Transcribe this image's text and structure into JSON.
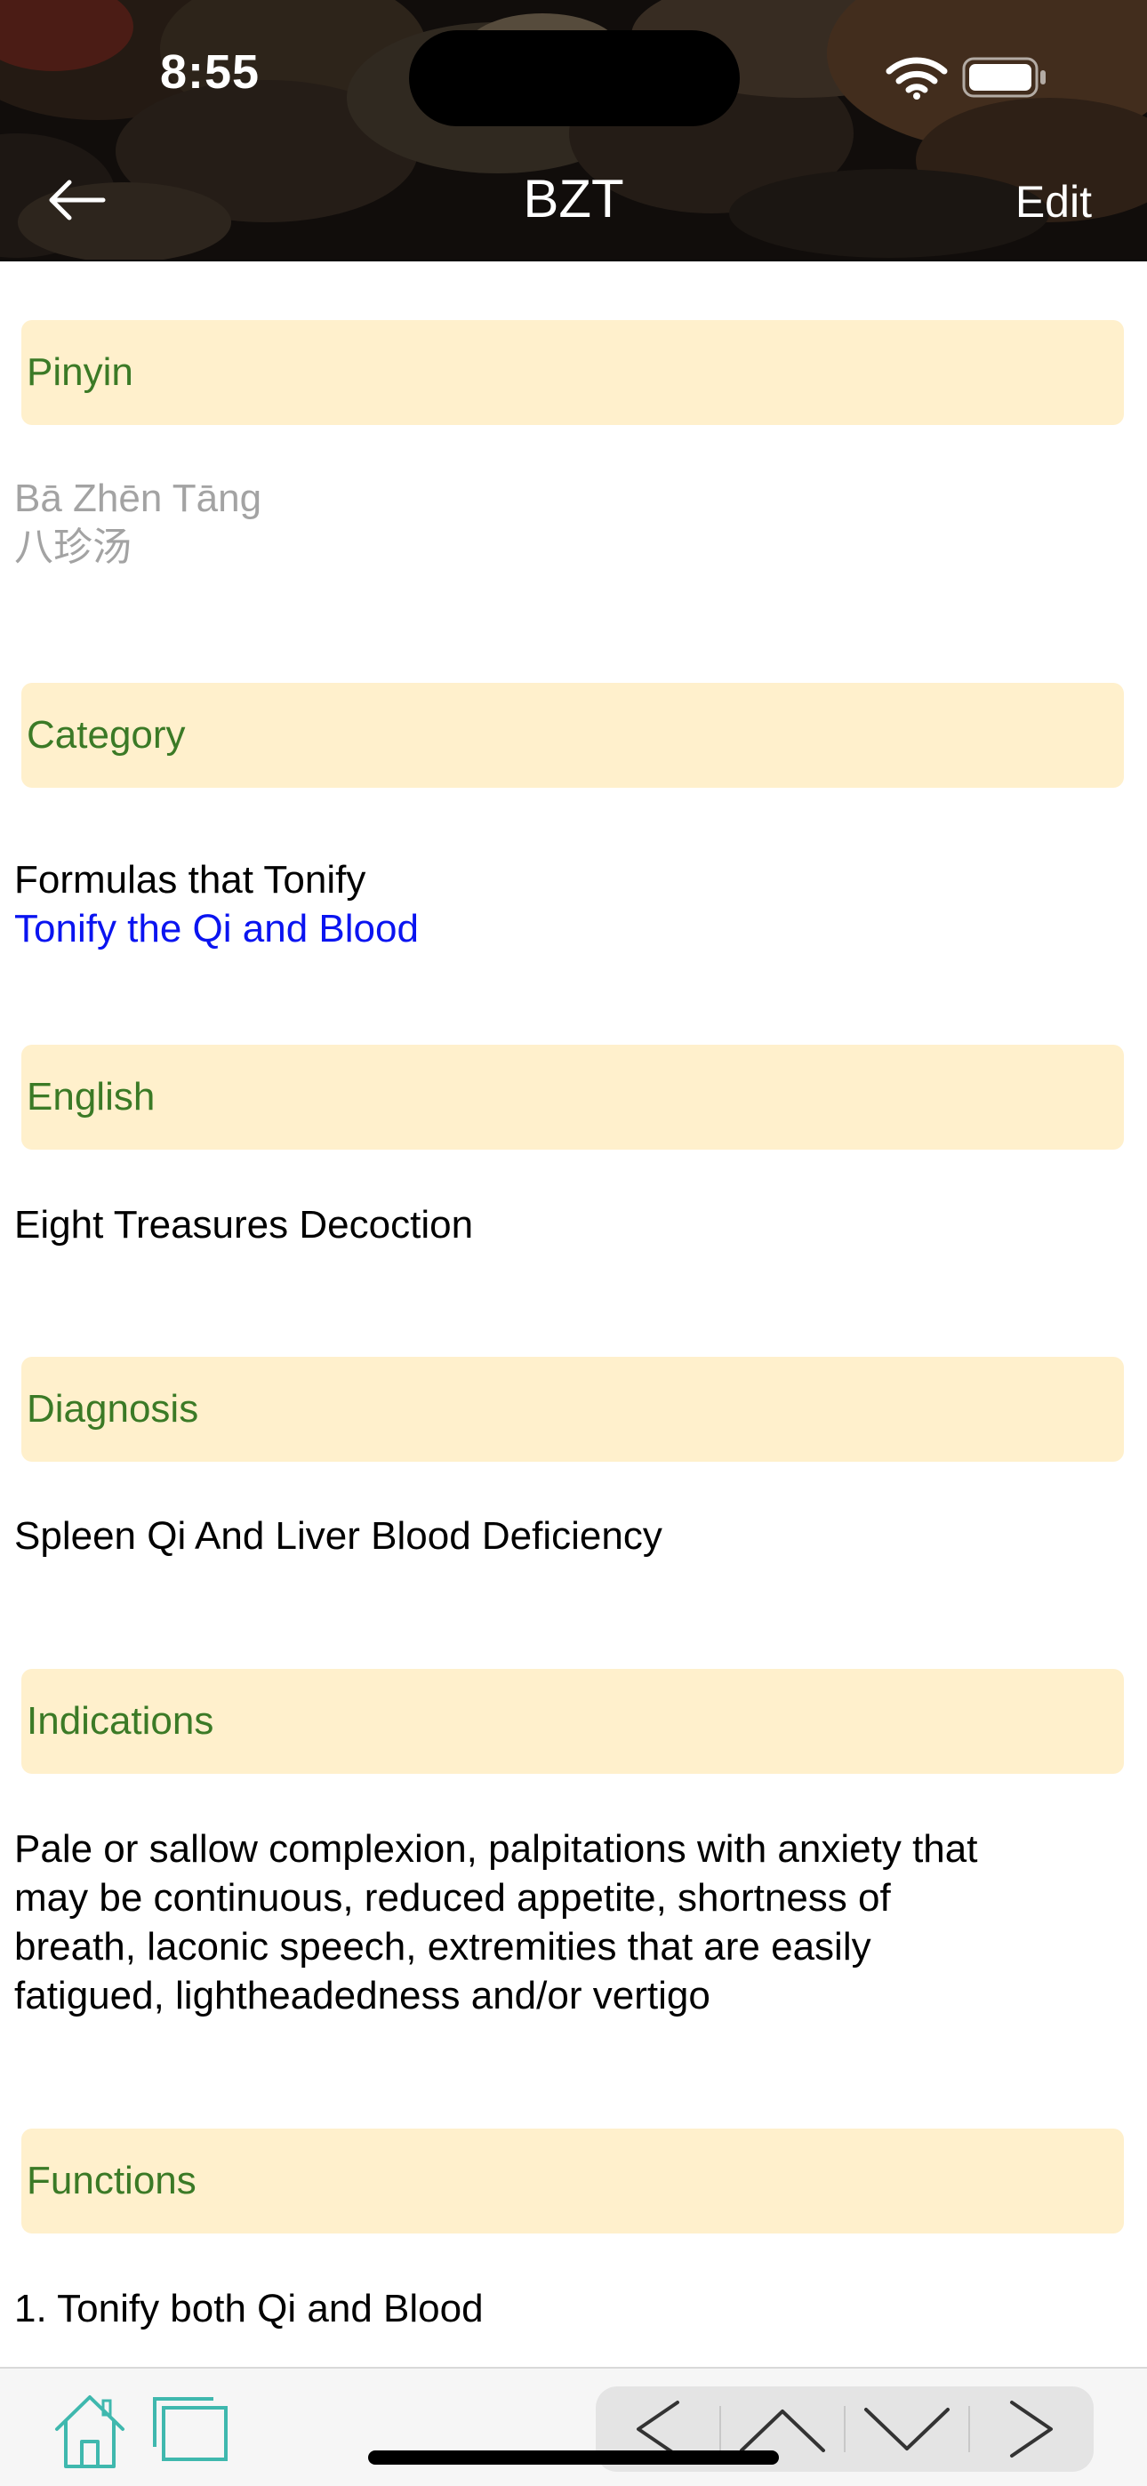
{
  "status_bar": {
    "time": "8:55",
    "wifi_icon": "wifi-icon",
    "battery_icon": "battery-icon"
  },
  "nav_bar": {
    "back_icon": "arrow-left-icon",
    "title": "BZT",
    "edit_label": "Edit"
  },
  "sections": {
    "pinyin": {
      "label": "Pinyin",
      "romanized": "Bā Zhēn Tāng",
      "chinese": "八珍汤"
    },
    "category": {
      "label": "Category",
      "primary": "Formulas that Tonify",
      "link": "Tonify the Qi and Blood"
    },
    "english": {
      "label": "English",
      "value": "Eight Treasures Decoction"
    },
    "diagnosis": {
      "label": "Diagnosis",
      "value": "Spleen Qi And Liver Blood Deficiency"
    },
    "indications": {
      "label": "Indications",
      "lines": [
        "Pale or sallow complexion, palpitations with anxiety that",
        "may be continuous, reduced appetite, shortness of",
        "breath, laconic speech, extremities that are easily",
        "fatigued, lightheadedness and/or vertigo"
      ]
    },
    "functions": {
      "label": "Functions",
      "item_1": "1. Tonify both Qi and Blood"
    }
  },
  "toolbar": {
    "home_icon": "home-icon",
    "windows_icon": "windows-icon",
    "prev_icon": "chevron-left-icon",
    "up_icon": "chevron-up-icon",
    "down_icon": "chevron-down-icon",
    "next_icon": "chevron-right-icon"
  },
  "colors": {
    "section_header_bg": "#fff0cc",
    "section_label": "#3b7a26",
    "link": "#0a14f0",
    "muted_text": "#a3a3a3",
    "toolbar_icon_teal": "#3fb8ae"
  }
}
